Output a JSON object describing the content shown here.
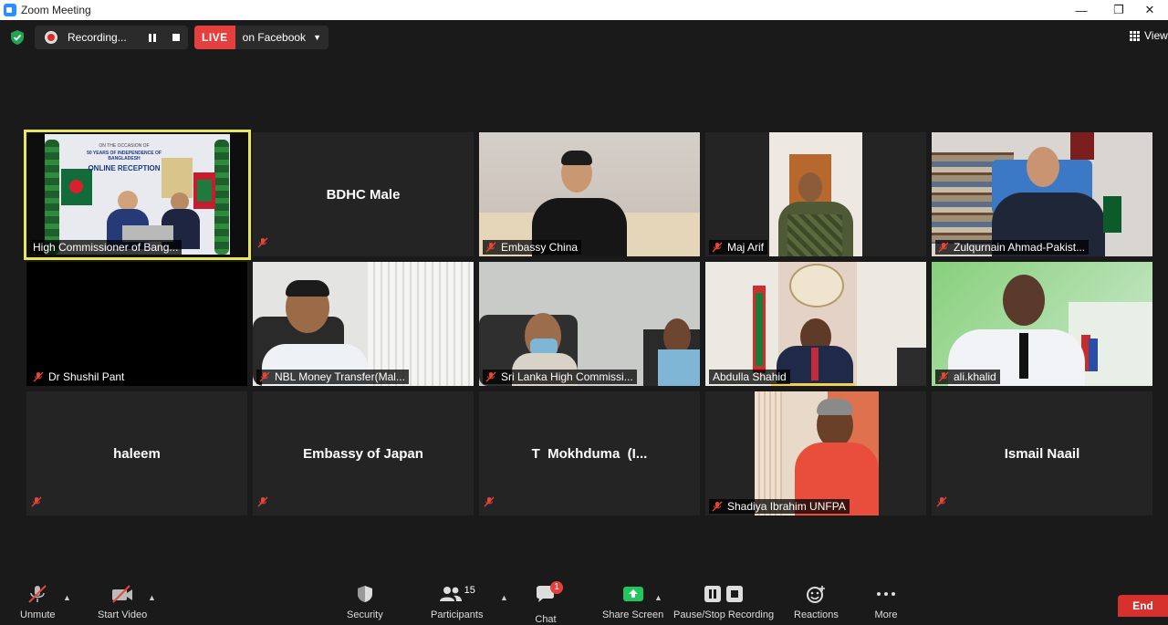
{
  "window": {
    "title": "Zoom Meeting",
    "controls": [
      "—",
      "❐",
      "✕"
    ]
  },
  "topbar": {
    "recording_label": "Recording...",
    "live_badge": "LIVE",
    "live_target": "on Facebook",
    "view_label": "View"
  },
  "participants": [
    {
      "name": "High Commissioner of Bang...",
      "muted": true,
      "video": true,
      "active": true,
      "slide": {
        "line1": "ON THE OCCASION OF",
        "line2": "50 YEARS OF INDEPENDENCE OF BANGLADESH",
        "line3": "ONLINE RECEPTION"
      }
    },
    {
      "name": "BDHC Male",
      "muted": true,
      "video": false
    },
    {
      "name": "Embassy China",
      "muted": true,
      "video": true
    },
    {
      "name": "Maj Arif",
      "muted": true,
      "video": true
    },
    {
      "name": "Zulqurnain Ahmad-Pakist...",
      "muted": true,
      "video": true
    },
    {
      "name": "Dr Shushil Pant",
      "muted": true,
      "video": true
    },
    {
      "name": "NBL Money Transfer(Mal...",
      "muted": true,
      "video": true
    },
    {
      "name": "Sri Lanka High Commissi...",
      "muted": true,
      "video": true
    },
    {
      "name": "Abdulla Shahid",
      "muted": false,
      "video": true
    },
    {
      "name": "ali.khalid",
      "muted": true,
      "video": true
    },
    {
      "name": "haleem",
      "muted": true,
      "video": false
    },
    {
      "name": "Embassy of Japan",
      "muted": true,
      "video": false
    },
    {
      "name": "T  Mokhduma  (I...",
      "muted": true,
      "video": false
    },
    {
      "name": "Shadiya Ibrahim UNFPA",
      "muted": true,
      "video": true
    },
    {
      "name": "Ismail Naail",
      "muted": true,
      "video": false
    }
  ],
  "toolbar": {
    "unmute_label": "Unmute",
    "video_label": "Start Video",
    "security_label": "Security",
    "participants_label": "Participants",
    "participants_count": "15",
    "chat_label": "Chat",
    "chat_badge": "1",
    "share_label": "Share Screen",
    "recording_label": "Pause/Stop Recording",
    "reactions_label": "Reactions",
    "more_label": "More",
    "end_label": "End"
  },
  "colors": {
    "active_border": "#e8e65a",
    "live_red": "#e5403d",
    "end_red": "#d7312d",
    "share_green": "#22c55e"
  }
}
